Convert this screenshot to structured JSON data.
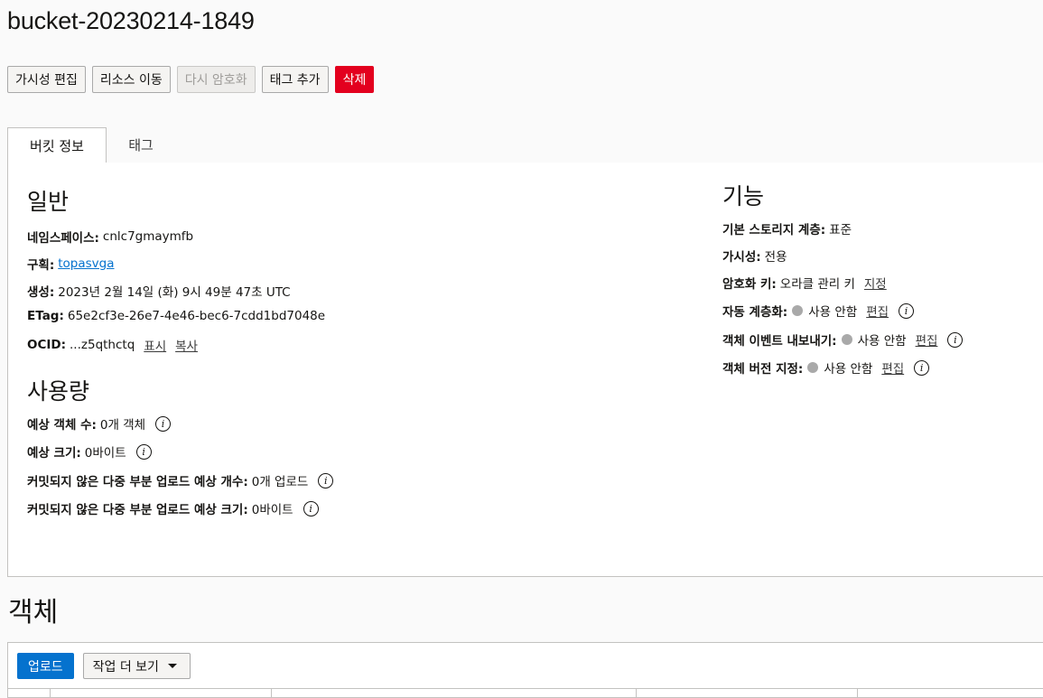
{
  "page": {
    "title": "bucket-20230214-1849"
  },
  "toolbar": {
    "edit_visibility": "가시성 편집",
    "move_resource": "리소스 이동",
    "reencrypt": "다시 암호화",
    "add_tags": "태그 추가",
    "delete": "삭제"
  },
  "tabs": {
    "bucket_info": "버킷 정보",
    "tags": "태그"
  },
  "general": {
    "heading": "일반",
    "namespace_label": "네임스페이스:",
    "namespace_value": "cnlc7gmaymfb",
    "compartment_label": "구획:",
    "compartment_value": "topasvga",
    "created_label": "생성:",
    "created_value": "2023년 2월 14일 (화) 9시 49분 47초 UTC",
    "etag_label": "ETag:",
    "etag_value": "65e2cf3e-26e7-4e46-bec6-7cdd1bd7048e",
    "ocid_label": "OCID:",
    "ocid_value": "...z5qthctq",
    "ocid_show": "표시",
    "ocid_copy": "복사"
  },
  "usage": {
    "heading": "사용량",
    "object_count_label": "예상 객체 수:",
    "object_count_value": "0개 객체",
    "size_label": "예상 크기:",
    "size_value": "0바이트",
    "uncommitted_count_label": "커밋되지 않은 다중 부분 업로드 예상 개수:",
    "uncommitted_count_value": "0개 업로드",
    "uncommitted_size_label": "커밋되지 않은 다중 부분 업로드 예상 크기:",
    "uncommitted_size_value": "0바이트"
  },
  "features": {
    "heading": "기능",
    "storage_tier_label": "기본 스토리지 계층:",
    "storage_tier_value": "표준",
    "visibility_label": "가시성:",
    "visibility_value": "전용",
    "encryption_label": "암호화 키:",
    "encryption_value": "오라클 관리 키",
    "encryption_assign": "지정",
    "auto_tiering_label": "자동 계층화:",
    "auto_tiering_value": "사용 안함",
    "events_label": "객체 이벤트 내보내기:",
    "events_value": "사용 안함",
    "versioning_label": "객체 버전 지정:",
    "versioning_value": "사용 안함",
    "edit": "편집",
    "status_color": "#a9a9a9"
  },
  "objects": {
    "heading": "객체",
    "upload": "업로드",
    "more_actions": "작업 더 보기"
  },
  "colors": {
    "primary": "#0572ce",
    "danger": "#e3001e"
  }
}
